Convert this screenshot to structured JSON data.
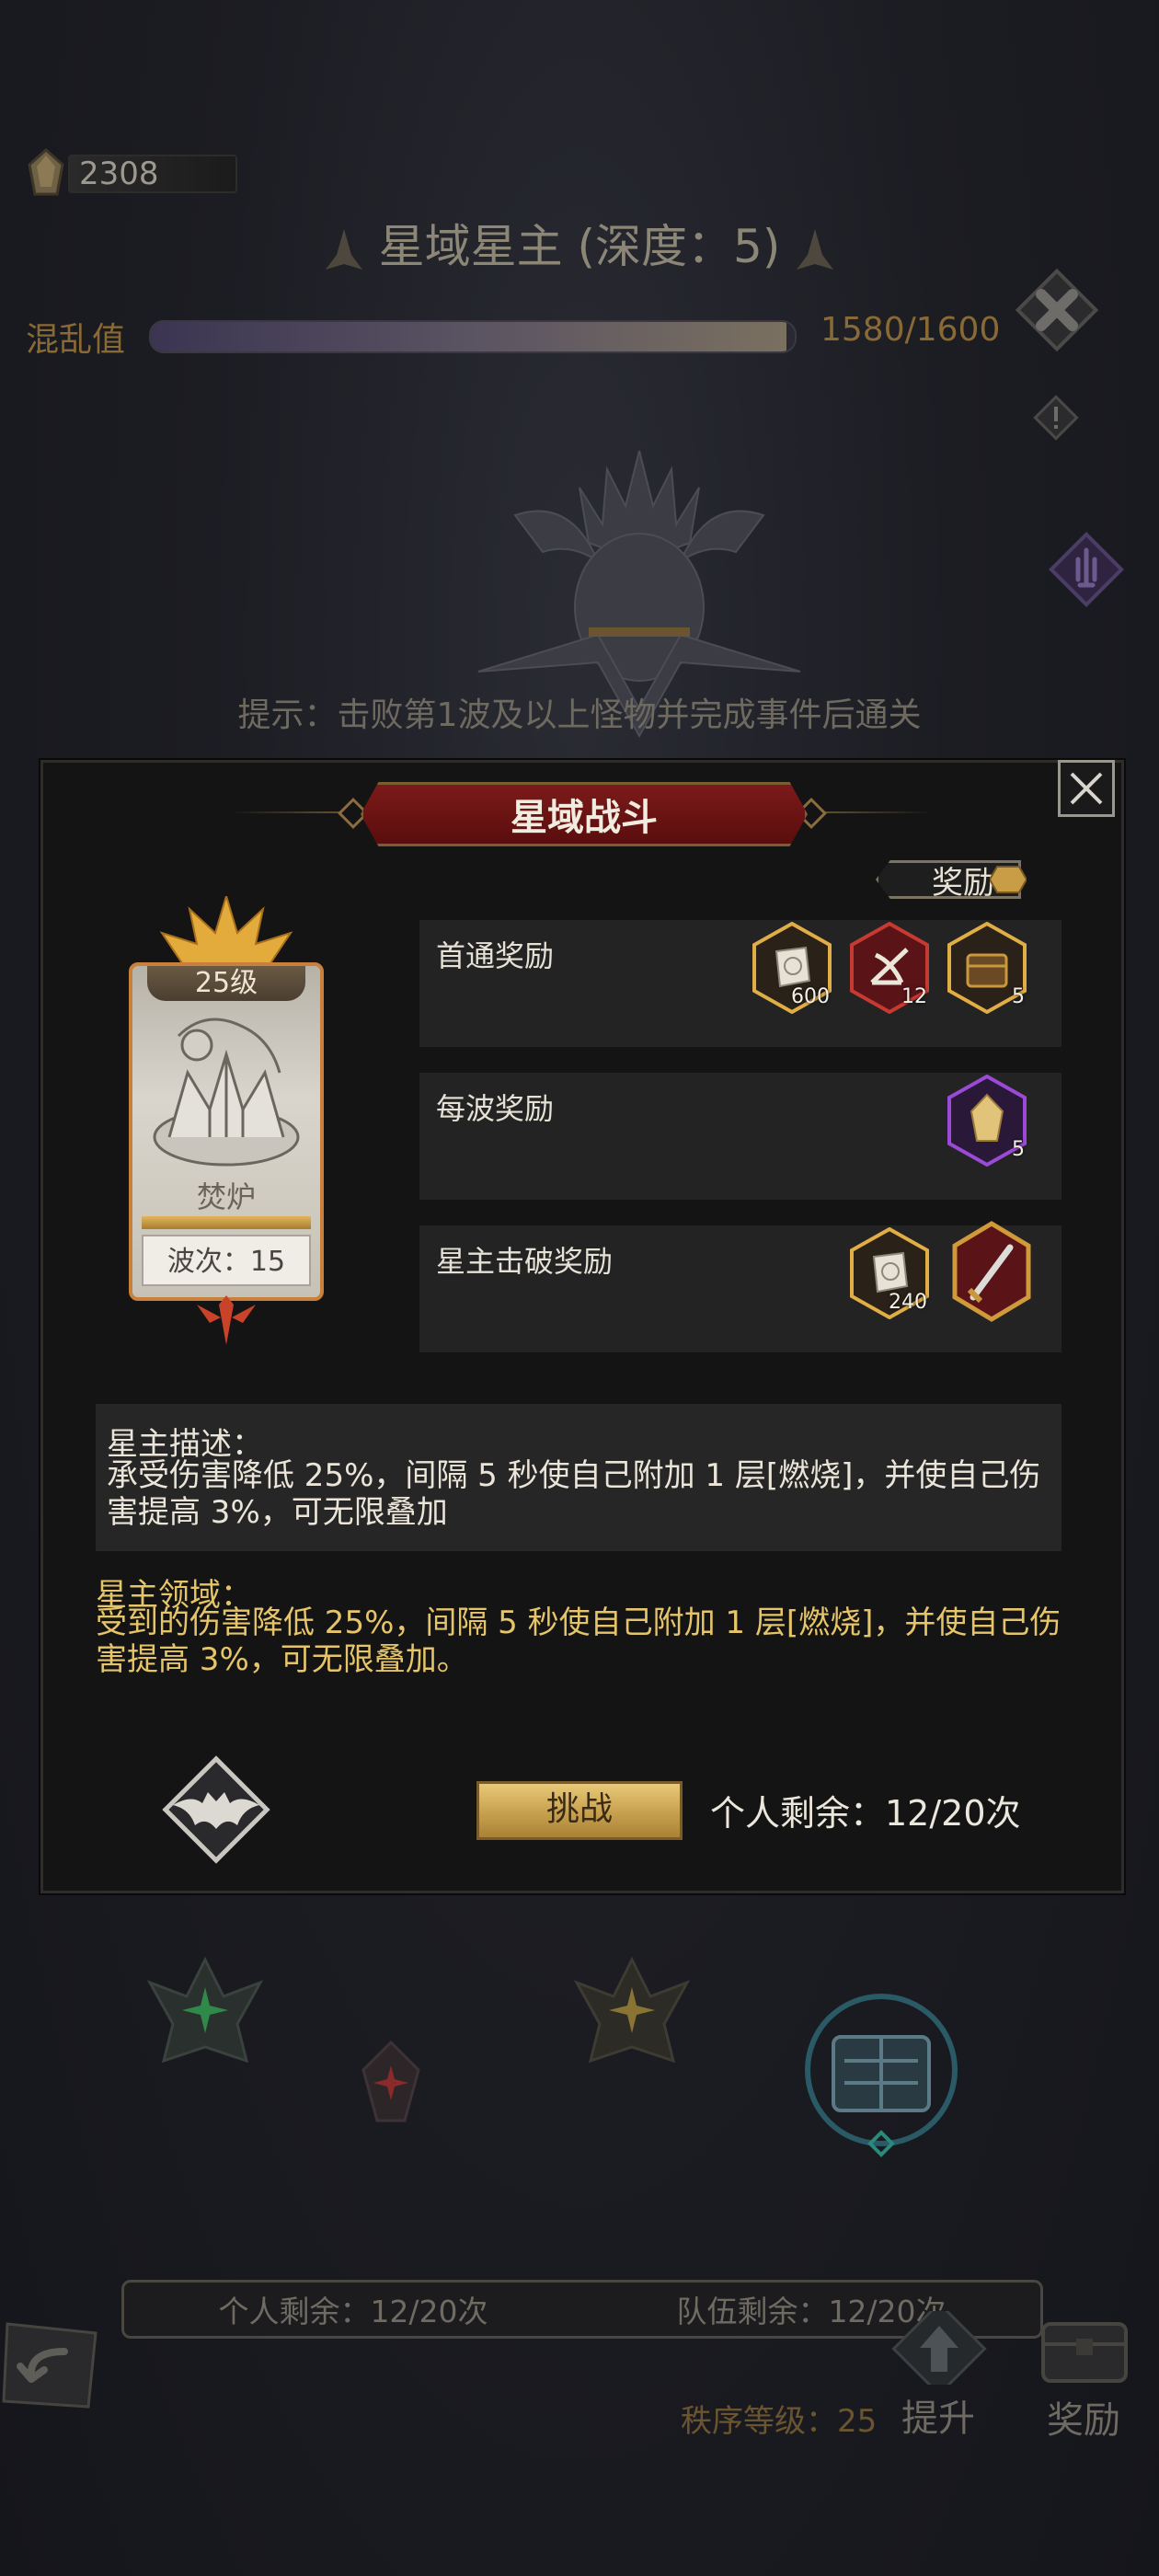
{
  "currency": {
    "value": "2308",
    "icon": "crystal-icon"
  },
  "header": {
    "title": "星域星主 (深度：5)"
  },
  "chaos": {
    "label": "混乱值",
    "current": 1580,
    "max": 1600,
    "text": "1580/1600"
  },
  "hint": "提示：击败第1波及以上怪物并完成事件后通关",
  "modal": {
    "title": "星域战斗",
    "reward_tag": "奖励",
    "boss_card": {
      "level": "25级",
      "name": "焚炉",
      "wave": "波次：15"
    },
    "reward_sections": [
      {
        "label": "首通奖励",
        "items": [
          {
            "icon": "scroll-icon",
            "count": "600",
            "rarity": "gold"
          },
          {
            "icon": "sextant-icon",
            "count": "12",
            "rarity": "red"
          },
          {
            "icon": "chest-icon",
            "count": "5",
            "rarity": "gold"
          }
        ]
      },
      {
        "label": "每波奖励",
        "items": [
          {
            "icon": "crystal-icon",
            "count": "5",
            "rarity": "purple"
          }
        ]
      },
      {
        "label": "星主击破奖励",
        "items": [
          {
            "icon": "scroll-icon",
            "count": "240",
            "rarity": "gold"
          },
          {
            "icon": "sword-icon",
            "count": "",
            "rarity": "red"
          }
        ]
      }
    ],
    "description": {
      "title": "星主描述：",
      "text": "承受伤害降低 25%，间隔 5 秒使自己附加 1 层[燃烧]，并使自己伤害提高 3%，可无限叠加"
    },
    "domain": {
      "title": "星主领域：",
      "text": "受到的伤害降低 25%，间隔 5 秒使自己附加 1 层[燃烧]，并使自己伤害提高 3%，可无限叠加。"
    },
    "challenge_label": "挑战",
    "personal_remaining": "个人剩余：12/20次"
  },
  "bottom": {
    "personal_remaining": "个人剩余：12/20次",
    "team_remaining": "队伍剩余：12/20次",
    "order_level": "秩序等级：25",
    "upgrade_label": "提升",
    "reward_label": "奖励"
  },
  "colors": {
    "accent_gold": "#e6c56a",
    "banner_red": "#7c1a1a",
    "panel": "#232323"
  }
}
